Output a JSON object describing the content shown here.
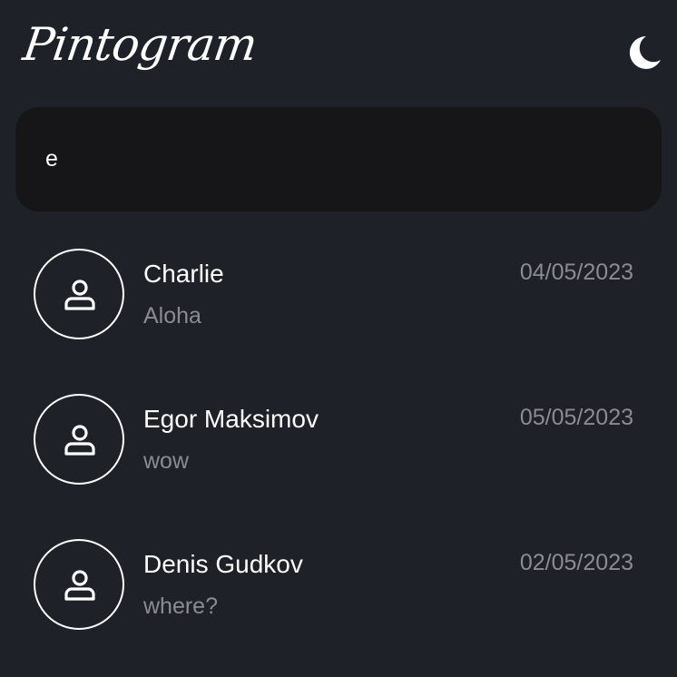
{
  "header": {
    "logo": "Pintogram",
    "theme_icon": "moon-icon"
  },
  "search": {
    "value": "e"
  },
  "chats": [
    {
      "name": "Charlie",
      "last_message": "Aloha",
      "date": "04/05/2023",
      "avatar_icon": "user-icon"
    },
    {
      "name": "Egor Maksimov",
      "last_message": "wow",
      "date": "05/05/2023",
      "avatar_icon": "user-icon"
    },
    {
      "name": "Denis Gudkov",
      "last_message": "where?",
      "date": "02/05/2023",
      "avatar_icon": "user-icon"
    }
  ],
  "colors": {
    "background": "#1f2128",
    "search_background": "#161618",
    "primary_text": "#ffffff",
    "secondary_text": "#8a8c92"
  }
}
